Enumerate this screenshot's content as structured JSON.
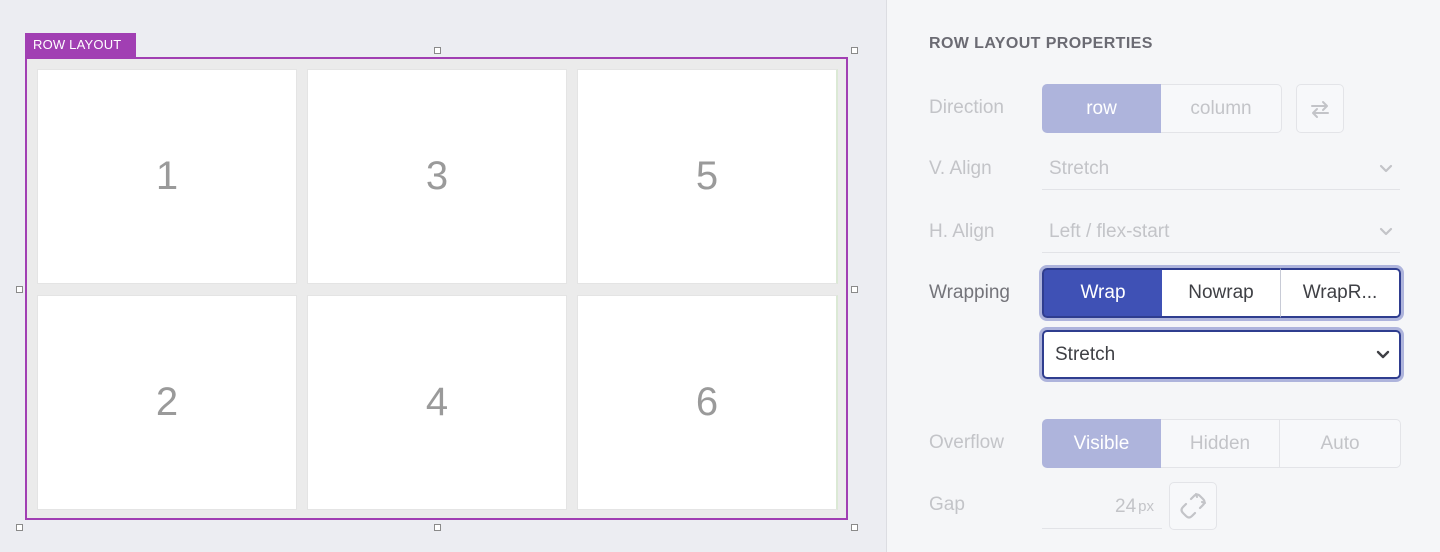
{
  "canvas": {
    "selection_tag": "ROW LAYOUT",
    "cells": [
      {
        "label": "1"
      },
      {
        "label": "3"
      },
      {
        "label": "5"
      },
      {
        "label": "2"
      },
      {
        "label": "4"
      },
      {
        "label": "6"
      }
    ]
  },
  "panel": {
    "title": "ROW LAYOUT PROPERTIES",
    "direction": {
      "label": "Direction",
      "options": [
        "row",
        "column"
      ],
      "selected": "row"
    },
    "v_align": {
      "label": "V. Align",
      "value": "Stretch"
    },
    "h_align": {
      "label": "H. Align",
      "value": "Left / flex-start"
    },
    "wrapping": {
      "label": "Wrapping",
      "options": [
        "Wrap",
        "Nowrap",
        "WrapR..."
      ],
      "selected": "Wrap",
      "align_value": "Stretch"
    },
    "overflow": {
      "label": "Overflow",
      "options": [
        "Visible",
        "Hidden",
        "Auto"
      ],
      "selected": "Visible"
    },
    "gap": {
      "label": "Gap",
      "value": "24",
      "unit": "px"
    }
  },
  "colors": {
    "selection": "#a13fb3",
    "accent": "#3f51b5",
    "accent_disabled": "#aeb4dc"
  }
}
